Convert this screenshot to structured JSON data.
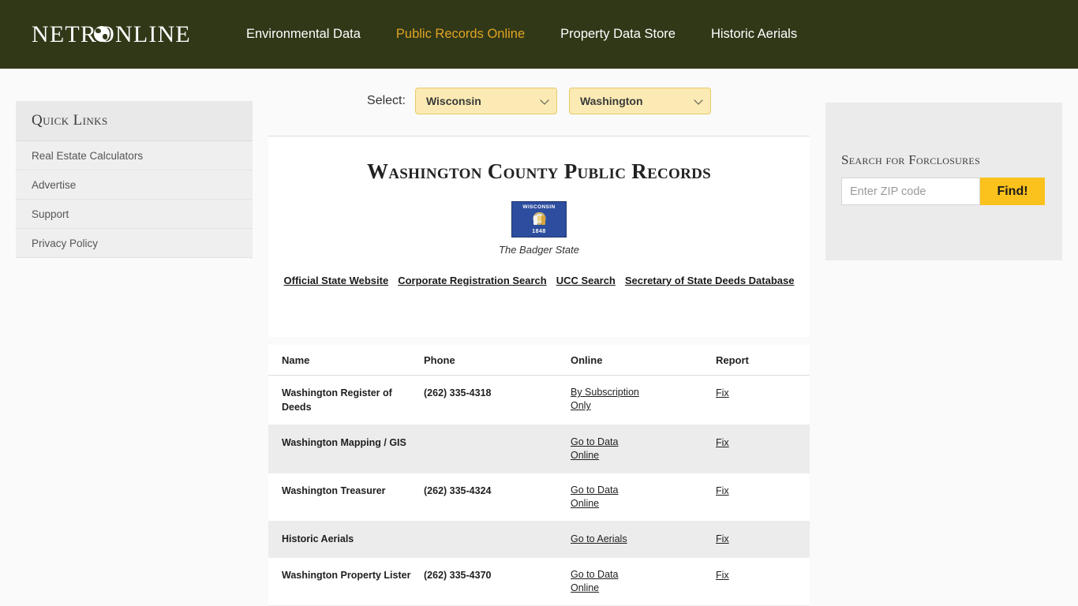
{
  "header": {
    "logo_text": "NETRONLINE",
    "logo_icon": "globe-icon",
    "nav": [
      {
        "label": "Environmental Data",
        "active": false
      },
      {
        "label": "Public Records Online",
        "active": true
      },
      {
        "label": "Property Data Store",
        "active": false
      },
      {
        "label": "Historic Aerials",
        "active": false
      }
    ]
  },
  "colors": {
    "header_bg": "#313818",
    "nav_active": "#e0a323",
    "page_bg": "#fafafa",
    "select_bg": "#fbeab3",
    "select_border": "#e8c96a",
    "find_button": "#fbc11c",
    "panel_bg": "#ebebeb",
    "row_alt": "#ececec",
    "flag_blue": "#2d4d9e"
  },
  "sidebar": {
    "title": "Quick Links",
    "items": [
      {
        "label": "Real Estate Calculators"
      },
      {
        "label": "Advertise"
      },
      {
        "label": "Support"
      },
      {
        "label": "Privacy Policy"
      }
    ]
  },
  "select_bar": {
    "label": "Select:",
    "state": {
      "value": "Wisconsin",
      "options": [
        "Wisconsin"
      ]
    },
    "county": {
      "value": "Washington",
      "options": [
        "Washington"
      ]
    }
  },
  "main": {
    "title": "Washington County Public Records",
    "flag": {
      "icon": "wisconsin-flag",
      "top_text": "WISCONSIN",
      "bottom_text": "1848",
      "caption": "The Badger State"
    },
    "state_links": [
      {
        "label": "Official State Website"
      },
      {
        "label": "Corporate Registration Search"
      },
      {
        "label": "UCC Search"
      },
      {
        "label": "Secretary of State Deeds Database"
      }
    ]
  },
  "table": {
    "columns": [
      "Name",
      "Phone",
      "Online",
      "Report"
    ],
    "rows": [
      {
        "name": "Washington Register of Deeds",
        "phone": "(262) 335-4318",
        "online": "By Subscription Only",
        "report": "Fix",
        "alt": false
      },
      {
        "name": "Washington Mapping / GIS",
        "phone": "",
        "online": "Go to Data Online",
        "report": "Fix",
        "alt": true
      },
      {
        "name": "Washington Treasurer",
        "phone": "(262) 335-4324",
        "online": "Go to Data Online",
        "report": "Fix",
        "alt": false
      },
      {
        "name": "Historic Aerials",
        "phone": "",
        "online": "Go to Aerials",
        "report": "Fix",
        "alt": true
      },
      {
        "name": "Washington Property Lister",
        "phone": "(262) 335-4370",
        "online": "Go to Data Online",
        "report": "Fix",
        "alt": false
      }
    ]
  },
  "foreclosure": {
    "title": "Search for Forclosures",
    "zip_placeholder": "Enter ZIP code",
    "zip_value": "",
    "button_label": "Find!"
  }
}
